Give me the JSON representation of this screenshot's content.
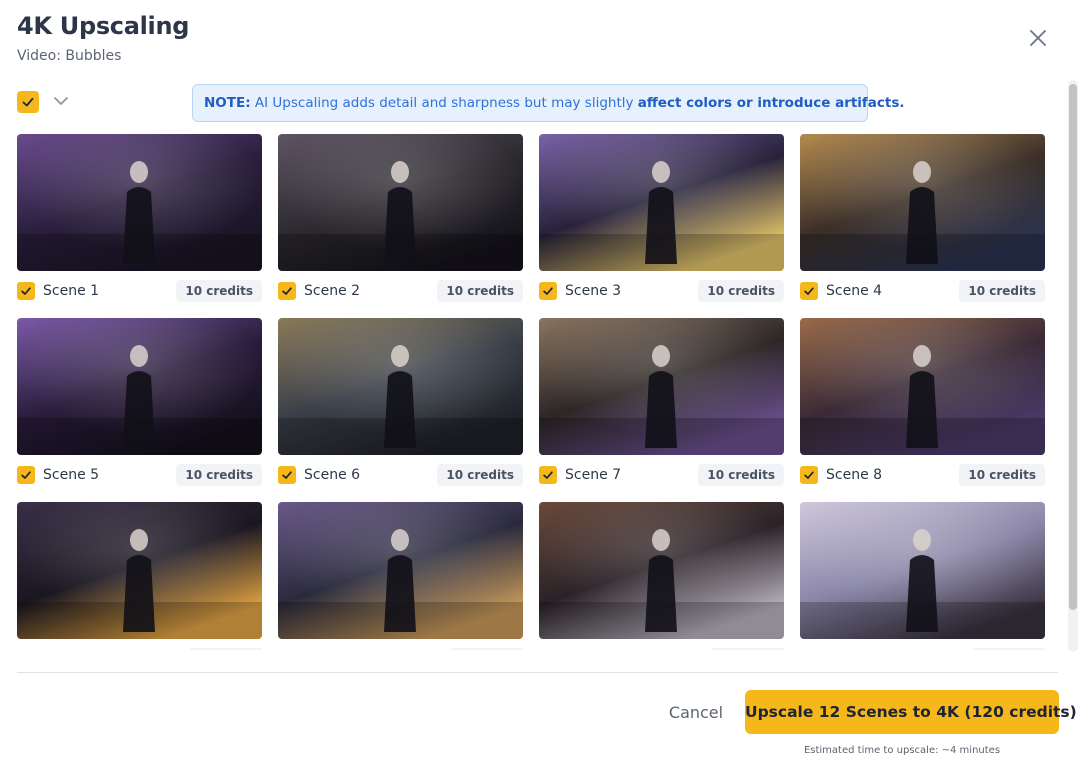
{
  "header": {
    "title": "4K Upscaling",
    "subtitle": "Video: Bubbles"
  },
  "note": {
    "prefix": "NOTE:",
    "text": " AI Upscaling adds detail and sharpness but may slightly ",
    "emphasis": "affect colors or introduce artifacts."
  },
  "scenes": [
    {
      "label": "Scene 1",
      "credits": "10 credits",
      "checked": true,
      "palette": [
        "#2a1f3d",
        "#6a4b8e",
        "#1a1424"
      ]
    },
    {
      "label": "Scene 2",
      "credits": "10 credits",
      "checked": true,
      "palette": [
        "#2d2a30",
        "#5e5563",
        "#15131a"
      ]
    },
    {
      "label": "Scene 3",
      "credits": "10 credits",
      "checked": true,
      "palette": [
        "#27223a",
        "#7a63a8",
        "#e3c56a"
      ]
    },
    {
      "label": "Scene 4",
      "credits": "10 credits",
      "checked": true,
      "palette": [
        "#3b2f28",
        "#b58b4f",
        "#2a3350"
      ]
    },
    {
      "label": "Scene 5",
      "credits": "10 credits",
      "checked": true,
      "palette": [
        "#2a1d3c",
        "#7b5aa8",
        "#14101d"
      ]
    },
    {
      "label": "Scene 6",
      "credits": "10 credits",
      "checked": true,
      "palette": [
        "#3a3f48",
        "#8a7a5a",
        "#1d2026"
      ]
    },
    {
      "label": "Scene 7",
      "credits": "10 credits",
      "checked": true,
      "palette": [
        "#2c2626",
        "#8a7560",
        "#6a4f8e"
      ]
    },
    {
      "label": "Scene 8",
      "credits": "10 credits",
      "checked": true,
      "palette": [
        "#3a2a36",
        "#9a6b4a",
        "#4a3a6a"
      ]
    },
    {
      "label": "",
      "credits": "",
      "checked": true,
      "palette": [
        "#1a1620",
        "#3a3048",
        "#e2a443"
      ]
    },
    {
      "label": "",
      "credits": "",
      "checked": true,
      "palette": [
        "#2a2a3c",
        "#6a5a8a",
        "#c99a5a"
      ]
    },
    {
      "label": "",
      "credits": "",
      "checked": true,
      "palette": [
        "#2a2228",
        "#6a4a3a",
        "#b9b3be"
      ]
    },
    {
      "label": "",
      "credits": "",
      "checked": true,
      "palette": [
        "#8a86a8",
        "#cfc8dc",
        "#3a3240"
      ]
    }
  ],
  "footer": {
    "cancel_label": "Cancel",
    "primary_label": "Upscale 12 Scenes to 4K (120 credits)",
    "eta": "Estimated time to upscale: ~4 minutes"
  },
  "colors": {
    "accent": "#f6b71a",
    "note_bg": "#e6f1fd",
    "note_text": "#2f72d8"
  },
  "icons": {
    "close": "close-icon",
    "select_menu": "chevron-down-icon",
    "check": "check-icon"
  }
}
